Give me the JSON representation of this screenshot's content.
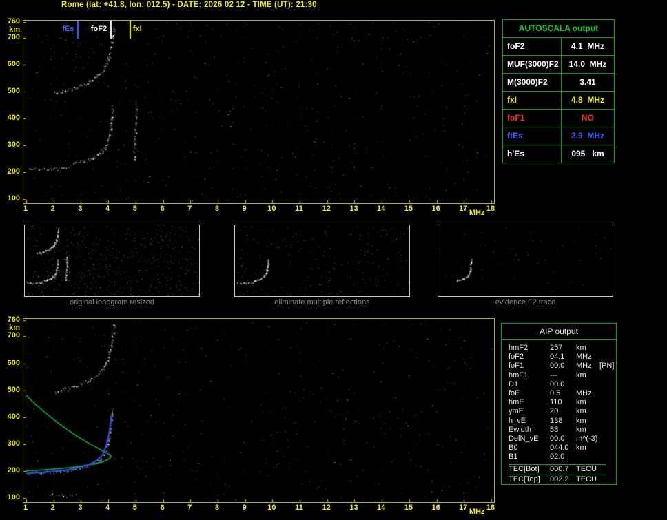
{
  "title": "Rome (lat: +41.8, lon: 012.5) - DATE: 2026 02 12 - TIME (UT): 21:30",
  "colors": {
    "accent_yellow": "#f2f200",
    "table_green": "#00aa00",
    "header_green": "#00cc33",
    "alert_red": "#ff2a2a",
    "marker_blue": "#3b62ff",
    "fit_blue": "#3348ff",
    "profile_green": "#00cc44"
  },
  "autoscala": {
    "header": "AUTOSCALA output",
    "rows": [
      {
        "label": "foF2",
        "value": "4.1  MHz",
        "color": "#ffffff"
      },
      {
        "label": "MUF(3000)F2",
        "value": "14.0  MHz",
        "color": "#ffffff"
      },
      {
        "label": "M(3000)F2",
        "value": "3.41",
        "color": "#ffffff"
      },
      {
        "label": "fxI",
        "value": "4.8  MHz",
        "color": "#f2f200"
      },
      {
        "label": "foF1",
        "value": "NO",
        "color": "#ff2a2a"
      },
      {
        "label": "ftEs",
        "value": "2.9  MHz",
        "color": "#3b62ff"
      },
      {
        "label": "h'Es",
        "value": "095   km",
        "color": "#ffffff"
      }
    ]
  },
  "aip": {
    "header": "AIP output",
    "rows": [
      {
        "label": "hmF2",
        "value": "257",
        "unit": "km",
        "note": ""
      },
      {
        "label": "foF2",
        "value": "04.1",
        "unit": "MHz",
        "note": ""
      },
      {
        "label": "foF1",
        "value": "00.0",
        "unit": "MHz",
        "note": "[PN]"
      },
      {
        "label": "hmF1",
        "value": "---",
        "unit": "km",
        "note": ""
      },
      {
        "label": "D1",
        "value": "00.0",
        "unit": "",
        "note": ""
      },
      {
        "label": "foE",
        "value": "0.5",
        "unit": "MHz",
        "note": ""
      },
      {
        "label": "hmE",
        "value": "110",
        "unit": "km",
        "note": ""
      },
      {
        "label": "ymE",
        "value": "20",
        "unit": "km",
        "note": ""
      },
      {
        "label": "h_vE",
        "value": "138",
        "unit": "km",
        "note": ""
      },
      {
        "label": "Ewidth",
        "value": "58",
        "unit": "km",
        "note": ""
      },
      {
        "label": "DelN_vE",
        "value": "00.0",
        "unit": "m^(-3)",
        "note": ""
      },
      {
        "label": "B0",
        "value": "044.0",
        "unit": "km",
        "note": ""
      },
      {
        "label": "B1",
        "value": "02.0",
        "unit": "",
        "note": ""
      },
      {
        "label": "TEC[Bot]",
        "value": "000.7",
        "unit": "TECU",
        "note": "",
        "tec": true
      },
      {
        "label": "TEC[Top]",
        "value": "002.2",
        "unit": "TECU",
        "note": "",
        "tec": true
      }
    ]
  },
  "thumbnails": [
    {
      "caption": "original ionogram resized",
      "traces": [
        "es-trace",
        "f2-first-order",
        "f2-second-order",
        "fx-asymptote"
      ],
      "noise_points": 620
    },
    {
      "caption": "eliminate multiple reflections",
      "traces": [
        "es-trace",
        "f2-first-order"
      ],
      "noise_points": 260
    },
    {
      "caption": "evidence F2 trace",
      "traces": [
        "f2-first-order"
      ],
      "noise_points": 70
    }
  ],
  "chart_data": [
    {
      "type": "scatter",
      "name": "autoscala-scaled-ionogram",
      "xlabel": "MHz",
      "ylabel": "km",
      "xlim": [
        1,
        18
      ],
      "ylim": [
        100,
        760
      ],
      "xticks": [
        1,
        2,
        3,
        4,
        5,
        6,
        7,
        8,
        9,
        10,
        11,
        12,
        13,
        14,
        15,
        16,
        17,
        18
      ],
      "yticks": [
        760,
        700,
        600,
        500,
        400,
        300,
        200,
        100
      ],
      "grid": "dotted",
      "noise_points": 540,
      "markers": [
        {
          "name": "fEs",
          "label": "fEs",
          "freq": 2.9,
          "color": "#3b62ff",
          "label_side": "left"
        },
        {
          "name": "foF2",
          "label": "foF2",
          "freq": 4.1,
          "color": "#ffffff",
          "label_side": "left"
        },
        {
          "name": "fxI",
          "label": "fxI",
          "freq": 4.8,
          "color": "#f2f200",
          "label_side": "right"
        }
      ],
      "traces": [
        {
          "name": "es-trace",
          "style": "speckle",
          "color": "#ffffff",
          "density": 0.55,
          "points": [
            [
              1.05,
              213
            ],
            [
              1.5,
              211
            ],
            [
              1.95,
              212
            ],
            [
              2.35,
              216
            ],
            [
              2.6,
              220
            ]
          ]
        },
        {
          "name": "f2-first-order",
          "style": "speckle",
          "color": "#ffffff",
          "density": 1.0,
          "points": [
            [
              2.7,
              235
            ],
            [
              3.1,
              243
            ],
            [
              3.45,
              255
            ],
            [
              3.7,
              270
            ],
            [
              3.88,
              292
            ],
            [
              4.0,
              322
            ],
            [
              4.08,
              360
            ],
            [
              4.13,
              405
            ],
            [
              4.16,
              442
            ]
          ]
        },
        {
          "name": "f2-second-order",
          "style": "speckle",
          "color": "#ffffff",
          "density": 1.0,
          "points": [
            [
              2.05,
              495
            ],
            [
              2.45,
              505
            ],
            [
              2.85,
              518
            ],
            [
              3.25,
              535
            ],
            [
              3.6,
              558
            ],
            [
              3.85,
              588
            ],
            [
              4.0,
              622
            ],
            [
              4.1,
              662
            ],
            [
              4.17,
              706
            ],
            [
              4.22,
              744
            ]
          ]
        },
        {
          "name": "fx-asymptote",
          "style": "speckle",
          "color": "#e8e8e8",
          "density": 0.85,
          "points": [
            [
              4.93,
              242
            ],
            [
              4.97,
              310
            ],
            [
              5.0,
              390
            ],
            [
              5.03,
              462
            ]
          ]
        }
      ]
    },
    {
      "type": "scatter",
      "name": "aip-ionogram-with-profile",
      "xlabel": "MHz",
      "ylabel": "km",
      "xlim": [
        1,
        18
      ],
      "ylim": [
        100,
        760
      ],
      "xticks": [
        1,
        2,
        3,
        4,
        5,
        6,
        7,
        8,
        9,
        10,
        11,
        12,
        13,
        14,
        15,
        16,
        17,
        18
      ],
      "yticks": [
        760,
        700,
        600,
        500,
        400,
        300,
        200,
        100
      ],
      "grid": "dotted",
      "noise_points": 470,
      "markers": [],
      "traces": [
        {
          "name": "es-trace",
          "style": "speckle",
          "color": "#ffffff",
          "density": 0.35,
          "points": [
            [
              1.85,
              113
            ],
            [
              2.3,
              110
            ],
            [
              2.8,
              112
            ]
          ]
        },
        {
          "name": "f2-first-order",
          "style": "speckle",
          "color": "#ffffff",
          "density": 1.0,
          "points": [
            [
              1.0,
              193
            ],
            [
              1.6,
              196
            ],
            [
              2.2,
              200
            ],
            [
              2.7,
              207
            ],
            [
              3.1,
              216
            ],
            [
              3.45,
              228
            ],
            [
              3.7,
              244
            ],
            [
              3.9,
              270
            ],
            [
              4.0,
              305
            ],
            [
              4.08,
              352
            ],
            [
              4.13,
              402
            ],
            [
              4.16,
              435
            ]
          ]
        },
        {
          "name": "f2-second-order",
          "style": "speckle",
          "color": "#ffffff",
          "density": 1.0,
          "points": [
            [
              2.05,
              495
            ],
            [
              2.45,
              505
            ],
            [
              2.85,
              518
            ],
            [
              3.25,
              535
            ],
            [
              3.6,
              558
            ],
            [
              3.85,
              588
            ],
            [
              4.0,
              622
            ],
            [
              4.1,
              662
            ],
            [
              4.17,
              706
            ],
            [
              4.22,
              744
            ]
          ]
        },
        {
          "name": "electron-density-profile",
          "style": "line",
          "color": "#00cc44",
          "width": 1.4,
          "points": [
            [
              1.0,
              481
            ],
            [
              1.3,
              452
            ],
            [
              1.6,
              425
            ],
            [
              1.9,
              400
            ],
            [
              2.2,
              376
            ],
            [
              2.5,
              354
            ],
            [
              2.8,
              333
            ],
            [
              3.1,
              314
            ],
            [
              3.4,
              297
            ],
            [
              3.65,
              283
            ],
            [
              3.85,
              272
            ],
            [
              4.0,
              264
            ],
            [
              4.1,
              257
            ],
            [
              4.07,
              249
            ],
            [
              3.95,
              241
            ],
            [
              3.75,
              233
            ],
            [
              3.45,
              226
            ],
            [
              3.05,
              219
            ],
            [
              2.6,
              213
            ],
            [
              2.1,
              208
            ],
            [
              1.55,
              204
            ],
            [
              1.0,
              201
            ]
          ]
        },
        {
          "name": "autoscala-fitted-trace",
          "style": "line",
          "color": "#3348ff",
          "width": 2,
          "points": [
            [
              1.0,
              191
            ],
            [
              1.7,
              196
            ],
            [
              2.4,
              203
            ],
            [
              2.9,
              212
            ],
            [
              3.3,
              224
            ],
            [
              3.6,
              240
            ],
            [
              3.8,
              262
            ],
            [
              3.93,
              295
            ],
            [
              4.02,
              335
            ],
            [
              4.08,
              375
            ],
            [
              4.11,
              408
            ]
          ]
        }
      ]
    }
  ]
}
